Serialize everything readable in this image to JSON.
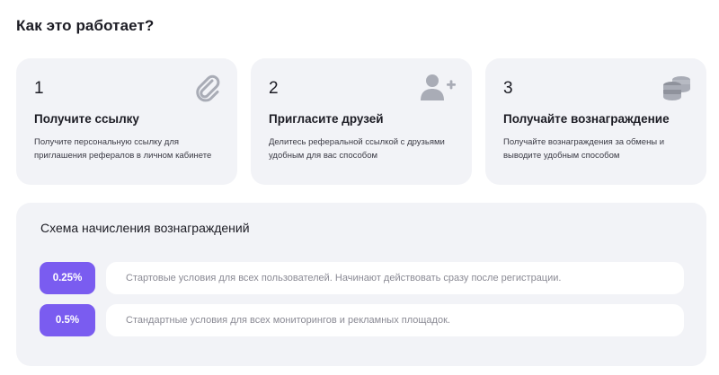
{
  "heading": "Как это работает?",
  "steps": [
    {
      "number": "1",
      "title": "Получите ссылку",
      "description": "Получите персональную ссылку для приглашения рефералов в личном кабинете",
      "icon": "paperclip-icon"
    },
    {
      "number": "2",
      "title": "Пригласите друзей",
      "description": "Делитесь реферальной ссылкой с друзьями удобным для вас способом",
      "icon": "add-user-icon"
    },
    {
      "number": "3",
      "title": "Получайте вознаграждение",
      "description": "Получайте вознаграждения за обмены и выводите удобным способом",
      "icon": "coins-stack-icon"
    }
  ],
  "rewards": {
    "title": "Схема начисления вознаграждений",
    "rows": [
      {
        "percent": "0.25%",
        "text": "Стартовые условия для всех пользователей. Начинают действовать сразу после регистрации."
      },
      {
        "percent": "0.5%",
        "text": "Стандартные условия для всех мониторингов и рекламных площадок."
      }
    ]
  },
  "colors": {
    "accent": "#7a5cf0",
    "card_bg": "#f2f3f7",
    "icon_gray": "#a9acb6"
  }
}
